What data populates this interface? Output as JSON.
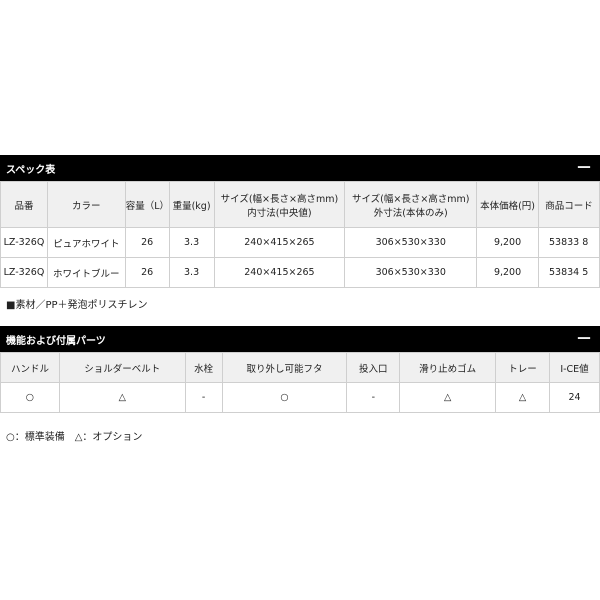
{
  "spec_section": {
    "title": "スペック表",
    "collapse_symbol": "－",
    "headers": [
      {
        "label": "品番",
        "line2": ""
      },
      {
        "label": "カラー",
        "line2": ""
      },
      {
        "label": "容量（L）",
        "line2": ""
      },
      {
        "label": "重量(kg)",
        "line2": ""
      },
      {
        "label": "サイズ(幅×長さ×高さmm)",
        "line2": "内寸法(中央値)"
      },
      {
        "label": "サイズ(幅×長さ×高さmm)",
        "line2": "外寸法(本体のみ)"
      },
      {
        "label": "本体価格(円)",
        "line2": ""
      },
      {
        "label": "商品コード",
        "line2": ""
      }
    ],
    "rows": [
      [
        "LZ-326Q",
        "ピュアホワイト",
        "26",
        "3.3",
        "240×415×265",
        "306×530×330",
        "9,200",
        "53833 8"
      ],
      [
        "LZ-326Q",
        "ホワイトブルー",
        "26",
        "3.3",
        "240×415×265",
        "306×530×330",
        "9,200",
        "53834 5"
      ]
    ],
    "material_note": "■素材／PP＋発泡ポリスチレン"
  },
  "parts_section": {
    "title": "機能および付属パーツ",
    "collapse_symbol": "－",
    "headers": [
      "ハンドル",
      "ショルダーベルト",
      "水栓",
      "取り外し可能フタ",
      "投入口",
      "滑り止めゴム",
      "トレー",
      "I-CE値"
    ],
    "values": [
      "○",
      "△",
      "-",
      "○",
      "-",
      "△",
      "△",
      "24"
    ],
    "legend": "○：標準装備　△：オプション"
  }
}
